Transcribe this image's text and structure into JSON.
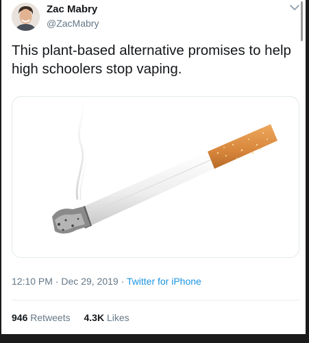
{
  "user": {
    "display_name": "Zac Mabry",
    "handle": "@ZacMabry"
  },
  "tweet": {
    "text": "This plant-based alternative promises to help high schoolers stop vaping.",
    "time": "12:10 PM",
    "date": "Dec 29, 2019",
    "separator": "·",
    "source": "Twitter for iPhone"
  },
  "stats": {
    "retweets_count": "946",
    "retweets_label": "Retweets",
    "likes_count": "4.3K",
    "likes_label": "Likes"
  },
  "icons": {
    "menu": "chevron-down-icon"
  },
  "colors": {
    "link": "#1b95e0",
    "secondary_text": "#657786",
    "primary_text": "#14171a"
  }
}
